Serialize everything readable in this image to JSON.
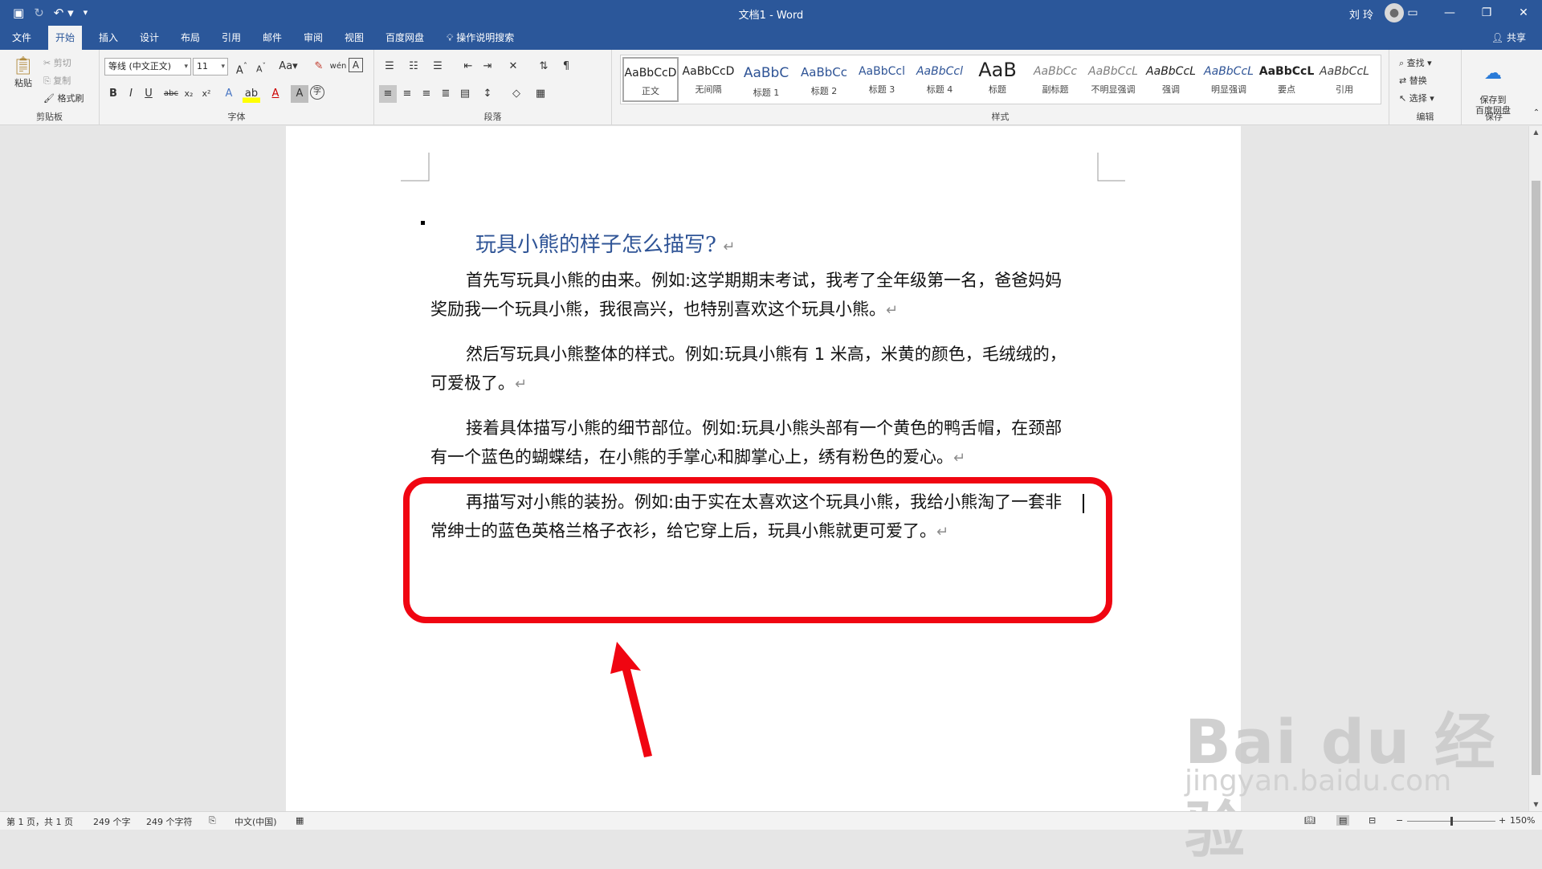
{
  "titlebar": {
    "doc_title": "文档1  -  Word",
    "user": "刘 玲",
    "qat": [
      "save-icon",
      "redo-icon",
      "undo-icon",
      "customize-icon"
    ]
  },
  "tabs": [
    "文件",
    "开始",
    "插入",
    "设计",
    "布局",
    "引用",
    "邮件",
    "审阅",
    "视图",
    "百度网盘"
  ],
  "active_tab": "开始",
  "tell_me": "操作说明搜索",
  "share": "共享",
  "ribbon": {
    "clipboard": {
      "paste": "粘贴",
      "cut": "剪切",
      "copy": "复制",
      "format_painter": "格式刷",
      "label": "剪贴板"
    },
    "font": {
      "name": "等线 (中文正文)",
      "size": "11",
      "label": "字体"
    },
    "paragraph": {
      "label": "段落"
    },
    "styles": {
      "label": "样式",
      "items": [
        {
          "sample": "AaBbCcD",
          "name": "正文"
        },
        {
          "sample": "AaBbCcD",
          "name": "无间隔"
        },
        {
          "sample": "AaBbC",
          "name": "标题 1"
        },
        {
          "sample": "AaBbCc",
          "name": "标题 2"
        },
        {
          "sample": "AaBbCcl",
          "name": "标题 3"
        },
        {
          "sample": "AaBbCcl",
          "name": "标题 4"
        },
        {
          "sample": "AaB",
          "name": "标题"
        },
        {
          "sample": "AaBbCc",
          "name": "副标题"
        },
        {
          "sample": "AaBbCcL",
          "name": "不明显强调"
        },
        {
          "sample": "AaBbCcL",
          "name": "强调"
        },
        {
          "sample": "AaBbCcL",
          "name": "明显强调"
        },
        {
          "sample": "AaBbCcL",
          "name": "要点"
        },
        {
          "sample": "AaBbCcL",
          "name": "引用"
        }
      ]
    },
    "editing": {
      "find": "查找",
      "replace": "替换",
      "select": "选择",
      "label": "编辑"
    },
    "save": {
      "button": "保存到\n百度网盘",
      "label": "保存"
    }
  },
  "document": {
    "heading": "玩具小熊的样子怎么描写?",
    "paragraphs": [
      "首先写玩具小熊的由来。例如:这学期期末考试，我考了全年级第一名，爸爸妈妈奖励我一个玩具小熊，我很高兴，也特别喜欢这个玩具小熊。",
      "然后写玩具小熊整体的样式。例如:玩具小熊有 1 米高，米黄的颜色，毛绒绒的，可爱极了。",
      "接着具体描写小熊的细节部位。例如:玩具小熊头部有一个黄色的鸭舌帽，在颈部有一个蓝色的蝴蝶结，在小熊的手掌心和脚掌心上，绣有粉色的爱心。",
      "再描写对小熊的装扮。例如:由于实在太喜欢这个玩具小熊，我给小熊淘了一套非常绅士的蓝色英格兰格子衣衫，给它穿上后，玩具小熊就更可爱了。"
    ],
    "paragraph_mark": "↵"
  },
  "annotation": {
    "box_color": "#f00511",
    "arrow_color": "#f00511"
  },
  "watermark": {
    "line1": "Bai du 经验",
    "line2": "jingyan.baidu.com"
  },
  "statusbar": {
    "page": "第 1 页，共 1 页",
    "words": "249 个字",
    "chars": "249 个字符",
    "language": "中文(中国)",
    "zoom": "150%"
  },
  "colors": {
    "brand": "#2b579a",
    "heading": "#2f5496"
  }
}
